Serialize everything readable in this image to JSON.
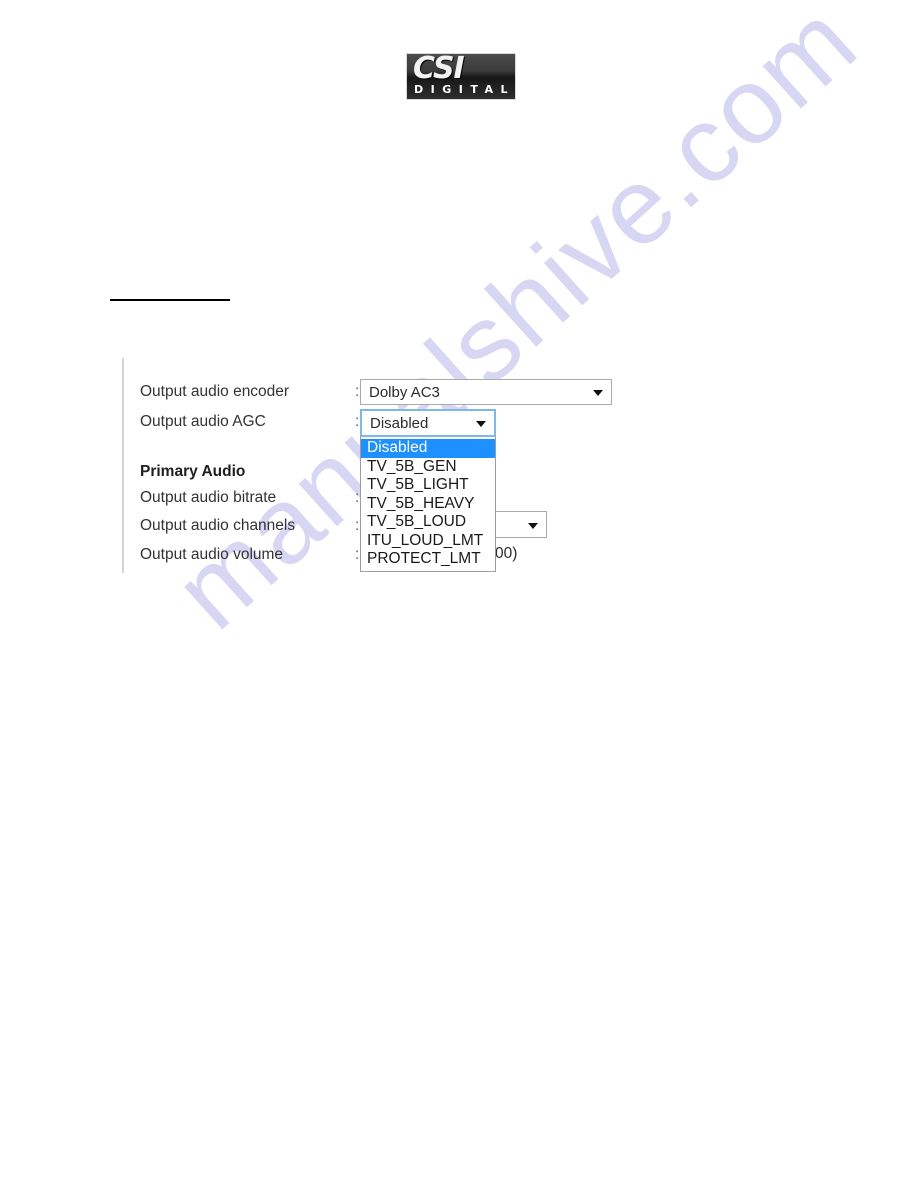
{
  "page": {
    "background_color": "#ffffff",
    "watermark_text": "manualshive.com",
    "watermark_color": "#d8d7f3"
  },
  "logo": {
    "primary_text": "CSI",
    "secondary_text": "DIGITAL",
    "background_color": "#2e2e2e",
    "text_color": "#ffffff"
  },
  "form": {
    "rows": [
      {
        "label": "Output audio encoder",
        "colon": ":"
      },
      {
        "label": "Output audio AGC",
        "colon": ":"
      },
      {
        "label": "Primary Audio",
        "colon": ""
      },
      {
        "label": "Output audio bitrate",
        "colon": ":"
      },
      {
        "label": "Output audio channels",
        "colon": ":"
      },
      {
        "label": "Output audio volume",
        "colon": ":"
      }
    ],
    "encoder_select": {
      "value": "Dolby AC3",
      "arrow": "chevron-down-icon",
      "border_color": "#a9a9a9"
    },
    "agc_select": {
      "value": "Disabled",
      "arrow": "chevron-down-icon",
      "focus_border_color": "#7fb8e8",
      "expanded": true,
      "options": [
        "Disabled",
        "TV_5B_GEN",
        "TV_5B_LIGHT",
        "TV_5B_HEAVY",
        "TV_5B_LOUD",
        "ITU_LOUD_LMT",
        "PROTECT_LMT"
      ],
      "selected_option": "Disabled",
      "highlight_color": "#1e90ff",
      "highlight_text_color": "#ffffff"
    },
    "channels_select": {
      "value": "",
      "arrow": "chevron-down-icon",
      "border_color": "#a9a9a9"
    },
    "volume_hint": "00)"
  }
}
